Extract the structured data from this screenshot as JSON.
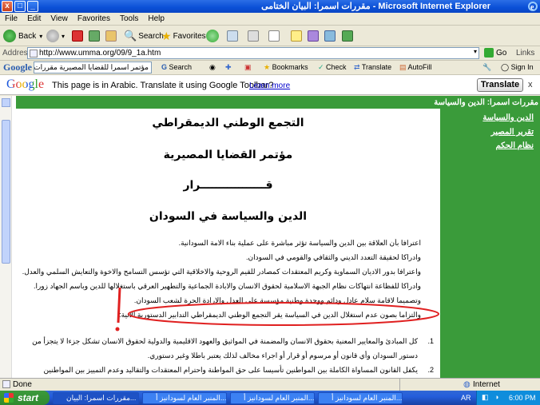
{
  "window": {
    "title": "مقررات اسمرا: البيان الختامى - Microsoft Internet Explorer",
    "controls": [
      "_",
      "□",
      "x"
    ]
  },
  "menu": [
    "File",
    "Edit",
    "View",
    "Favorites",
    "Tools",
    "Help"
  ],
  "toolbar": {
    "back": "Back",
    "search": "Search",
    "favorites": "Favorites"
  },
  "address": {
    "label": "Address",
    "url": "http://www.umma.org/09/9_1a.htm",
    "go": "Go",
    "links": "Links"
  },
  "google_toolbar": {
    "logo": "Google",
    "query": "مؤتمر اسمرا للقضايا المصيرية مقررات",
    "search": "Search",
    "bookmarks": "Bookmarks",
    "check": "Check",
    "translate": "Translate",
    "autofill": "AutoFill",
    "signin": "Sign In"
  },
  "translate_bar": {
    "logo": "Google",
    "message": "This page is in Arabic.  Translate it using Google Toolbar?",
    "learn_more": "Learn more",
    "button": "Translate",
    "close": "x"
  },
  "sidebar": {
    "heading": "مقررات اسمرا: الدين والسياسة",
    "links": [
      "الدين والسياسة",
      "تقرير المصير",
      "نظام الحكم"
    ]
  },
  "article": {
    "title1": "التجمع الوطني الديمقراطي",
    "title2": "مؤتمر القضايا المصيرية",
    "title3": "قـــــــــــــــــرار",
    "title4": "الدين والسياسة في السودان",
    "bullets": [
      "اعترافا بأن العلاقة بين الدين والسياسة تؤثر مباشرة على عملية بناء الامة السودانية.",
      "وادراكا لحقيقة التعدد الديني والثقافي والقومي في السودان.",
      "واعترافا بدور الاديان السماوية وكريم المعتقدات كمصادر للقيم الروحية والاخلاقية التي تؤسس التسامح والاخوة والتعايش السلمي والعدل.",
      "وادراكا للفظاعة انتهاكات نظام الجبهة الاسلامية لحقوق الانسان والابادة الجماعية والتطهير العرقي باستغلالها للدين وباسم الجهاد زورا.",
      "وتصميما لاقامة سلام عادل ودائم ووحدة وطنية مؤسسة على العدل والارادة الحرة لشعب السودان.",
      "والتزاما بصون عدم استغلال الدين في السياسة يقر التجمع الوطني الديمقراطي التدابير الدستورية الاتية:"
    ],
    "numbered": [
      {
        "n": "1.",
        "text": "كل المبادئ والمعايير المعنية بحقوق الانسان والمضمنة في المواثيق والعهود الاقليمية والدولية لحقوق الانسان تشكل جزءا لا يتجزأ من دستور السودان وأي قانون أو مرسوم أو قرار أو اجراء مخالف لذلك يعتبر باطلا وغير دستوري."
      },
      {
        "n": "2.",
        "text": "يكفل القانون المساواة الكاملة بين المواطنين تأسيسا على حق المواطنة واحترام المعتقدات والتقاليد وعدم التمييز بين المواطنين"
      }
    ]
  },
  "status": {
    "text": "Done",
    "zone": "Internet"
  },
  "taskbar": {
    "start": "start",
    "tasks": [
      "مقررات اسمرا: البيان...",
      "المنبر العام لسودانيز أ...",
      "المنبر العام لسودانيز أ...",
      "المنبر العام لسودانيز أ..."
    ],
    "lang": "AR",
    "time": "6:00 PM"
  },
  "colors": {
    "sidebar_green": "#3a9b3a",
    "annotation_red": "#e02020",
    "title_blue": "#0a4fd6"
  }
}
